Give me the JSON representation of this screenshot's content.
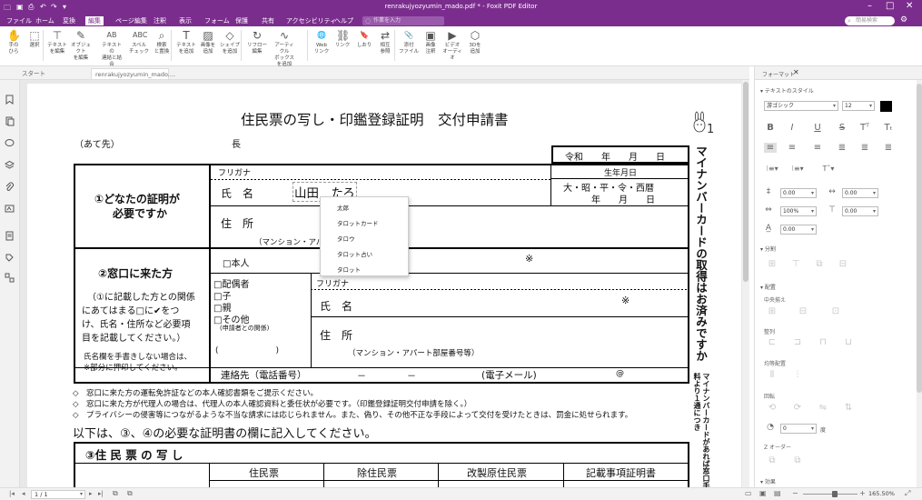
{
  "titlebar": {
    "title": "renrakujyozyumin_mado.pdf * - Foxit PDF Editor"
  },
  "menu": {
    "items": [
      "ファイル",
      "ホーム",
      "変換",
      "編集",
      "ページ編集",
      "注釈",
      "表示",
      "フォーム",
      "保護",
      "共有",
      "アクセシビリティ",
      "ヘルプ"
    ],
    "active": "編集",
    "search_placeholder": "作業を入力",
    "find_placeholder": "簡易検索"
  },
  "ribbon": {
    "buttons": [
      {
        "l1": "手の",
        "l2": "ひら"
      },
      {
        "l1": "選択",
        "l2": ""
      },
      {
        "l1": "テキスト",
        "l2": "を編集"
      },
      {
        "l1": "オブジェクト",
        "l2": "を編集"
      },
      {
        "l1": "テキストの",
        "l2": "連結と結合"
      },
      {
        "l1": "スペル",
        "l2": "チェック"
      },
      {
        "l1": "検索",
        "l2": "と置換"
      },
      {
        "l1": "テキスト",
        "l2": "を追加"
      },
      {
        "l1": "画像を",
        "l2": "追加"
      },
      {
        "l1": "シェイプ",
        "l2": "を追加"
      },
      {
        "l1": "リフロー",
        "l2": "編集"
      },
      {
        "l1": "アーティクル",
        "l2": "ボックスを追加"
      },
      {
        "l1": "Web",
        "l2": "リンク"
      },
      {
        "l1": "リンク",
        "l2": ""
      },
      {
        "l1": "しおり",
        "l2": ""
      },
      {
        "l1": "相互",
        "l2": "参照"
      },
      {
        "l1": "添付",
        "l2": "ファイル"
      },
      {
        "l1": "画像",
        "l2": "注釈"
      },
      {
        "l1": "ビデオ",
        "l2": "オーディオ"
      },
      {
        "l1": "3Dを",
        "l2": "追加"
      }
    ]
  },
  "tabs": {
    "start": "スタート",
    "doc": "renrakujyozyumin_mado...."
  },
  "status": {
    "page": "1 / 1",
    "zoom": "165.50%"
  },
  "panel": {
    "title": "フォーマット",
    "text_style": "テキストのスタイル",
    "font": "游ゴシック",
    "size": "12",
    "spacing1": "0.00",
    "spacing2": "0.00",
    "scale": "100%",
    "spacing3": "0.00",
    "spacing4": "0.00",
    "split": "分割",
    "layout": "配置",
    "center": "中央揃え",
    "align": "整列",
    "distribute": "均等配置",
    "rotate": "回転",
    "degree_value": "0",
    "degree_unit": "度",
    "order": "Z オーダー",
    "effect": "効果"
  },
  "form": {
    "title": "住民票の写し・印鑑登録証明　交付申請書",
    "to": "（あて先）",
    "chief": "長",
    "era": "令和　　年　　月　　日",
    "birth": "生年月日",
    "eras": "大・昭・平・令・西暦",
    "ymd": "年　　月　　日",
    "side_text": "マイナンバーカードの取得はお済みですか",
    "side_small": "マイナンバーカードがあれば窓口手数料より１通につき",
    "s1_title": "①どなたの証明が",
    "s1_title2": "必要ですか",
    "furigana": "フリガナ",
    "name_label": "氏　名",
    "name_value": "山田　たろ",
    "addr_label": "住　所",
    "mansion": "（マンション・アパ",
    "s2_title": "②窓口に来た方",
    "s2_desc1": "（①に記載した方との関係",
    "s2_desc2": "にあてはまる□に✔をつ",
    "s2_desc3": "け、氏名・住所など必要項",
    "s2_desc4": "目を記載してください。）",
    "s2_note1": "氏名欄を手書きしない場合は、",
    "s2_note2": "※部分に押印してください。",
    "self": "□本人",
    "mark": "※",
    "spouse": "□配偶者",
    "child": "□子",
    "parent": "□親",
    "other": "□その他",
    "relation": "(申請者との関係)",
    "bracket": "(　　　　　　　)",
    "furigana2": "フリガナ",
    "name2": "氏　名",
    "mark2": "※",
    "addr2": "住　所",
    "mansion2": "（マンション・アパート部屋番号等）",
    "contact": "連絡先（電話番号）",
    "dash1": "－",
    "dash2": "－",
    "email": "(電子メール)",
    "at": "@",
    "note1": "◇　窓口に来た方の運転免許証などの本人確認書類をご提示ください。",
    "note2": "◇　窓口に来た方が代理人の場合は、代理人の本人確認資料と委任状が必要です。（印鑑登録証明交付申請を除く。）",
    "note3": "◇　プライバシーの侵害等につながるような不当な請求には応じられません。また、偽り、その他不正な手段によって交付を受けたときは、罰金に処せられます。",
    "heading": "以下は、③、④の必要な証明書の欄に記入してください。",
    "s3_title": "③住 民 票 の 写 し",
    "col1": "住民票",
    "col2": "除住民票",
    "col3": "改製原住民票",
    "col4": "記載事項証明書"
  },
  "context_menu": [
    "太郎",
    "タロットカード",
    "タロウ",
    "タロット占い",
    "タロット"
  ]
}
